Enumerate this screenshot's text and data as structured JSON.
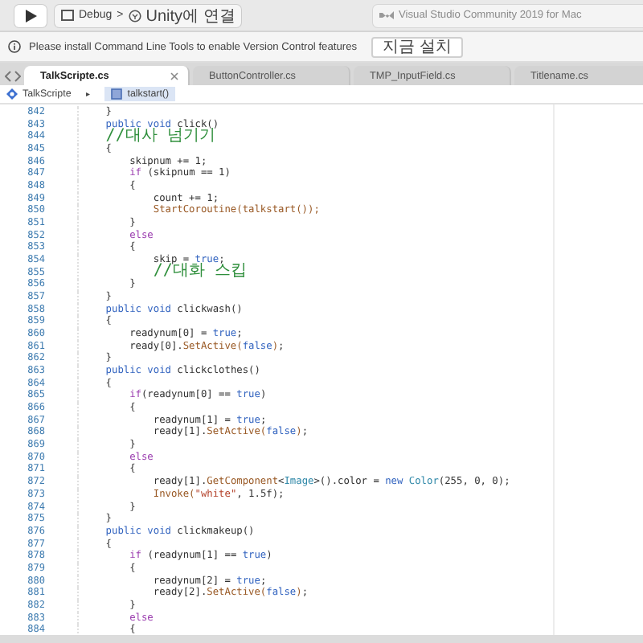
{
  "toolbar": {
    "scheme": "Debug",
    "separator": ">",
    "target": "Unity에 연결",
    "status": "Visual Studio Community 2019 for Mac"
  },
  "info_bar": {
    "message": "Please install Command Line Tools to enable Version Control features",
    "button": "지금 설치"
  },
  "tabs": [
    {
      "label": "TalkScripte.cs",
      "selected": true
    },
    {
      "label": "ButtonController.cs",
      "selected": false
    },
    {
      "label": "TMP_InputField.cs",
      "selected": false
    },
    {
      "label": "Titlename.cs",
      "selected": false
    }
  ],
  "breadcrumb": {
    "class": "TalkScripte",
    "separator": "▸",
    "member": "talkstart()"
  },
  "code_lines": [
    {
      "number": "842",
      "tokens": [
        {
          "kind": "plain",
          "text": "    }"
        }
      ]
    },
    {
      "number": "843",
      "tokens": [
        {
          "kind": "keyword",
          "text": "    public void"
        },
        {
          "kind": "plain",
          "text": " click()"
        }
      ]
    },
    {
      "number": "844",
      "tokens": [
        {
          "kind": "comment",
          "text": "    //대사 넘기기"
        }
      ]
    },
    {
      "number": "845",
      "tokens": [
        {
          "kind": "plain",
          "text": "    {"
        }
      ]
    },
    {
      "number": "846",
      "tokens": [
        {
          "kind": "plain",
          "text": "        skipnum += 1;"
        }
      ]
    },
    {
      "number": "847",
      "tokens": [
        {
          "kind": "control",
          "text": "        if"
        },
        {
          "kind": "plain",
          "text": " (skipnum == 1)"
        }
      ]
    },
    {
      "number": "848",
      "tokens": [
        {
          "kind": "plain",
          "text": "        {"
        }
      ]
    },
    {
      "number": "849",
      "tokens": [
        {
          "kind": "plain",
          "text": "            count += 1;"
        }
      ]
    },
    {
      "number": "850",
      "tokens": [
        {
          "kind": "method",
          "text": "            StartCoroutine(talkstart());"
        }
      ]
    },
    {
      "number": "851",
      "tokens": [
        {
          "kind": "plain",
          "text": "        }"
        }
      ]
    },
    {
      "number": "852",
      "tokens": [
        {
          "kind": "control",
          "text": "        else"
        }
      ]
    },
    {
      "number": "853",
      "tokens": [
        {
          "kind": "plain",
          "text": "        {"
        }
      ]
    },
    {
      "number": "854",
      "tokens": [
        {
          "kind": "plain",
          "text": "            skip = "
        },
        {
          "kind": "keyword",
          "text": "true"
        },
        {
          "kind": "plain",
          "text": ";"
        }
      ]
    },
    {
      "number": "855",
      "tokens": [
        {
          "kind": "comment",
          "text": "            //대화 스킵"
        }
      ]
    },
    {
      "number": "856",
      "tokens": [
        {
          "kind": "plain",
          "text": "        }"
        }
      ]
    },
    {
      "number": "857",
      "tokens": [
        {
          "kind": "plain",
          "text": "    }"
        }
      ]
    },
    {
      "number": "858",
      "tokens": [
        {
          "kind": "keyword",
          "text": "    public void"
        },
        {
          "kind": "plain",
          "text": " clickwash()"
        }
      ]
    },
    {
      "number": "859",
      "tokens": [
        {
          "kind": "plain",
          "text": "    {"
        }
      ]
    },
    {
      "number": "860",
      "tokens": [
        {
          "kind": "plain",
          "text": "        readynum[0] = "
        },
        {
          "kind": "keyword",
          "text": "true"
        },
        {
          "kind": "plain",
          "text": ";"
        }
      ]
    },
    {
      "number": "861",
      "tokens": [
        {
          "kind": "plain",
          "text": "        ready[0]."
        },
        {
          "kind": "method",
          "text": "SetActive("
        },
        {
          "kind": "keyword",
          "text": "false"
        },
        {
          "kind": "method",
          "text": ")"
        },
        {
          "kind": "plain",
          "text": ";"
        }
      ]
    },
    {
      "number": "862",
      "tokens": [
        {
          "kind": "plain",
          "text": "    }"
        }
      ]
    },
    {
      "number": "863",
      "tokens": [
        {
          "kind": "keyword",
          "text": "    public void"
        },
        {
          "kind": "plain",
          "text": " clickclothes()"
        }
      ]
    },
    {
      "number": "864",
      "tokens": [
        {
          "kind": "plain",
          "text": "    {"
        }
      ]
    },
    {
      "number": "865",
      "tokens": [
        {
          "kind": "control",
          "text": "        if"
        },
        {
          "kind": "plain",
          "text": "(readynum[0] == "
        },
        {
          "kind": "keyword",
          "text": "true"
        },
        {
          "kind": "plain",
          "text": ")"
        }
      ]
    },
    {
      "number": "866",
      "tokens": [
        {
          "kind": "plain",
          "text": "        {"
        }
      ]
    },
    {
      "number": "867",
      "tokens": [
        {
          "kind": "plain",
          "text": "            readynum[1] = "
        },
        {
          "kind": "keyword",
          "text": "true"
        },
        {
          "kind": "plain",
          "text": ";"
        }
      ]
    },
    {
      "number": "868",
      "tokens": [
        {
          "kind": "plain",
          "text": "            ready[1]."
        },
        {
          "kind": "method",
          "text": "SetActive("
        },
        {
          "kind": "keyword",
          "text": "false"
        },
        {
          "kind": "method",
          "text": ")"
        },
        {
          "kind": "plain",
          "text": ";"
        }
      ]
    },
    {
      "number": "869",
      "tokens": [
        {
          "kind": "plain",
          "text": "        }"
        }
      ]
    },
    {
      "number": "870",
      "tokens": [
        {
          "kind": "control",
          "text": "        else"
        }
      ]
    },
    {
      "number": "871",
      "tokens": [
        {
          "kind": "plain",
          "text": "        {"
        }
      ]
    },
    {
      "number": "872",
      "tokens": [
        {
          "kind": "plain",
          "text": "            ready[1]."
        },
        {
          "kind": "method",
          "text": "GetComponent"
        },
        {
          "kind": "plain",
          "text": "<"
        },
        {
          "kind": "type",
          "text": "Image"
        },
        {
          "kind": "plain",
          "text": ">().color = "
        },
        {
          "kind": "keyword",
          "text": "new"
        },
        {
          "kind": "type",
          "text": " Color"
        },
        {
          "kind": "plain",
          "text": "(255, 0, 0);"
        }
      ]
    },
    {
      "number": "873",
      "tokens": [
        {
          "kind": "method",
          "text": "            Invoke("
        },
        {
          "kind": "string",
          "text": "\"white\""
        },
        {
          "kind": "plain",
          "text": ", 1.5f);"
        }
      ]
    },
    {
      "number": "874",
      "tokens": [
        {
          "kind": "plain",
          "text": "        }"
        }
      ]
    },
    {
      "number": "875",
      "tokens": [
        {
          "kind": "plain",
          "text": "    }"
        }
      ]
    },
    {
      "number": "876",
      "tokens": [
        {
          "kind": "keyword",
          "text": "    public void"
        },
        {
          "kind": "plain",
          "text": " clickmakeup()"
        }
      ]
    },
    {
      "number": "877",
      "tokens": [
        {
          "kind": "plain",
          "text": "    {"
        }
      ]
    },
    {
      "number": "878",
      "tokens": [
        {
          "kind": "control",
          "text": "        if"
        },
        {
          "kind": "plain",
          "text": " (readynum[1] == "
        },
        {
          "kind": "keyword",
          "text": "true"
        },
        {
          "kind": "plain",
          "text": ")"
        }
      ]
    },
    {
      "number": "879",
      "tokens": [
        {
          "kind": "plain",
          "text": "        {"
        }
      ]
    },
    {
      "number": "880",
      "tokens": [
        {
          "kind": "plain",
          "text": "            readynum[2] = "
        },
        {
          "kind": "keyword",
          "text": "true"
        },
        {
          "kind": "plain",
          "text": ";"
        }
      ]
    },
    {
      "number": "881",
      "tokens": [
        {
          "kind": "plain",
          "text": "            ready[2]."
        },
        {
          "kind": "method",
          "text": "SetActive("
        },
        {
          "kind": "keyword",
          "text": "false"
        },
        {
          "kind": "method",
          "text": ")"
        },
        {
          "kind": "plain",
          "text": ";"
        }
      ]
    },
    {
      "number": "882",
      "tokens": [
        {
          "kind": "plain",
          "text": "        }"
        }
      ]
    },
    {
      "number": "883",
      "tokens": [
        {
          "kind": "control",
          "text": "        else"
        }
      ]
    },
    {
      "number": "884",
      "tokens": [
        {
          "kind": "plain",
          "text": "        {"
        }
      ]
    }
  ]
}
